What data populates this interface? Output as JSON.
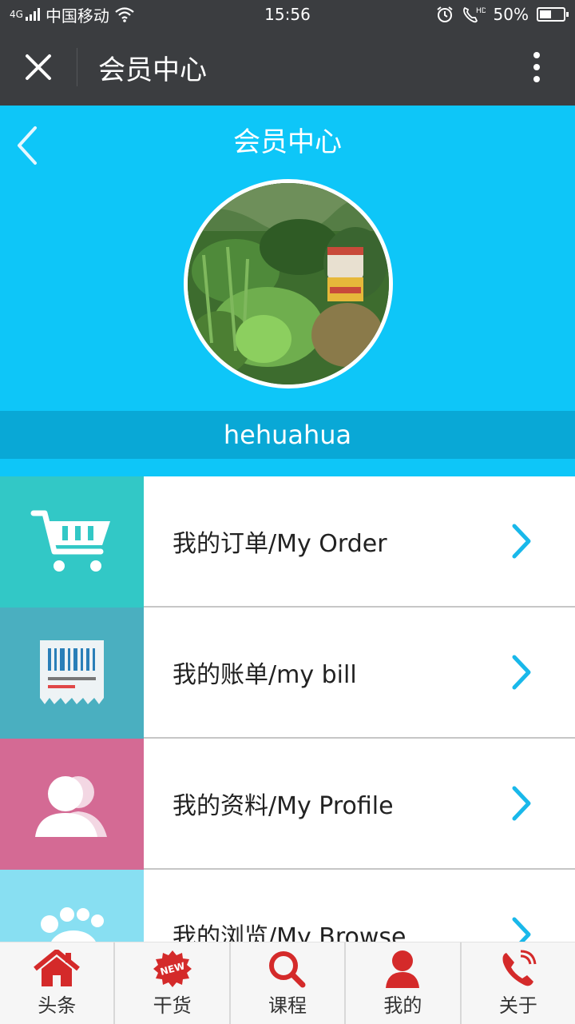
{
  "status_bar": {
    "carrier": "中国移动",
    "network": "4G",
    "time": "15:56",
    "battery": "50%",
    "battery_level": 0.5
  },
  "titlebar": {
    "title": "会员中心",
    "close_icon": "close-icon",
    "more_icon": "more-vertical-icon"
  },
  "hero": {
    "title": "会员中心",
    "username": "hehuahua",
    "back_icon": "chevron-left-icon"
  },
  "menu": {
    "items": [
      {
        "label": "我的订单/My Order",
        "icon": "cart-icon",
        "color": "#32c8c6"
      },
      {
        "label": "我的账单/my bill",
        "icon": "receipt-icon",
        "color": "#4aafc0"
      },
      {
        "label": "我的资料/My Profile",
        "icon": "users-icon",
        "color": "#d46a94"
      },
      {
        "label": "我的浏览/My Browse",
        "icon": "footprint-icon",
        "color": "#88dff2"
      }
    ]
  },
  "tabbar": {
    "tabs": [
      {
        "label": "头条",
        "icon": "home-icon"
      },
      {
        "label": "干货",
        "icon": "new-badge-icon"
      },
      {
        "label": "课程",
        "icon": "search-icon"
      },
      {
        "label": "我的",
        "icon": "user-icon"
      },
      {
        "label": "关于",
        "icon": "phone-icon"
      }
    ],
    "accent": "#d42a2a"
  },
  "colors": {
    "header_dark": "#3b3d40",
    "hero_blue": "#0ec6f8",
    "username_bar": "#09a8d6",
    "chevron": "#19b8ea"
  }
}
